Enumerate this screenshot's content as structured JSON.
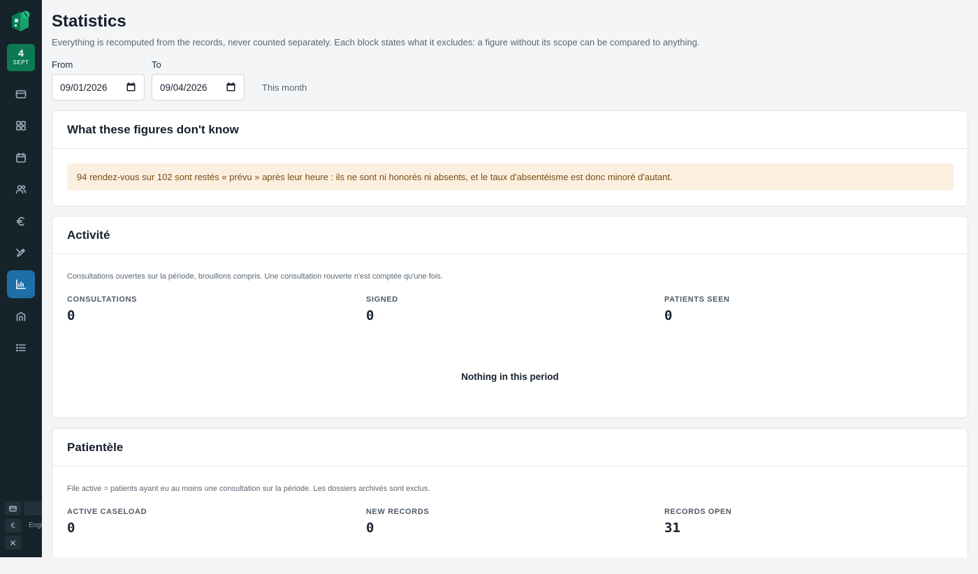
{
  "sidebar": {
    "date_badge": {
      "day": "4",
      "month": "SEPT"
    },
    "nav": [
      {
        "name": "billing",
        "icon": "credit-card-icon"
      },
      {
        "name": "dashboard",
        "icon": "grid-icon"
      },
      {
        "name": "calendar",
        "icon": "calendar-icon"
      },
      {
        "name": "patients",
        "icon": "users-icon"
      },
      {
        "name": "finance",
        "icon": "euro-icon"
      },
      {
        "name": "tools",
        "icon": "pen-icon"
      },
      {
        "name": "statistics",
        "icon": "bar-chart-icon",
        "active": true
      },
      {
        "name": "practice",
        "icon": "building-icon"
      },
      {
        "name": "lists",
        "icon": "list-icon"
      }
    ],
    "footer": {
      "currency_symbol": "€",
      "language": "English"
    }
  },
  "page": {
    "title": "Statistics",
    "intro": "Everything is recomputed from the records, never counted separately. Each block states what it excludes: a figure without its scope can be compared to anything."
  },
  "filters": {
    "from_label": "From",
    "from_value": "09/01/2026",
    "to_label": "To",
    "to_value": "09/04/2026",
    "quick_range": "This month"
  },
  "limits_card": {
    "title": "What these figures don't know",
    "warning": "94 rendez-vous sur 102 sont restés « prévu » après leur heure : ils ne sont ni honorés ni absents, et le taux d'absentéisme est donc minoré d'autant."
  },
  "activity_card": {
    "title": "Activité",
    "scope": "Consultations ouvertes sur la période, brouillons compris. Une consultation rouverte n'est comptée qu'une fois.",
    "stats": [
      {
        "label": "CONSULTATIONS",
        "value": "0"
      },
      {
        "label": "SIGNED",
        "value": "0"
      },
      {
        "label": "PATIENTS SEEN",
        "value": "0"
      }
    ],
    "empty": "Nothing in this period"
  },
  "caseload_card": {
    "title": "Patientèle",
    "scope": "File active = patients ayant eu au moins une consultation sur la période. Les dossiers archivés sont exclus.",
    "stats": [
      {
        "label": "ACTIVE CASELOAD",
        "value": "0"
      },
      {
        "label": "NEW RECORDS",
        "value": "0"
      },
      {
        "label": "RECORDS OPEN",
        "value": "31"
      }
    ]
  },
  "colors": {
    "sidebar_bg": "#17232b",
    "brand_green": "#0b7a52",
    "active_nav": "#1e6fa8",
    "warning_bg": "#fbefdf",
    "warning_text": "#7a4c14"
  }
}
